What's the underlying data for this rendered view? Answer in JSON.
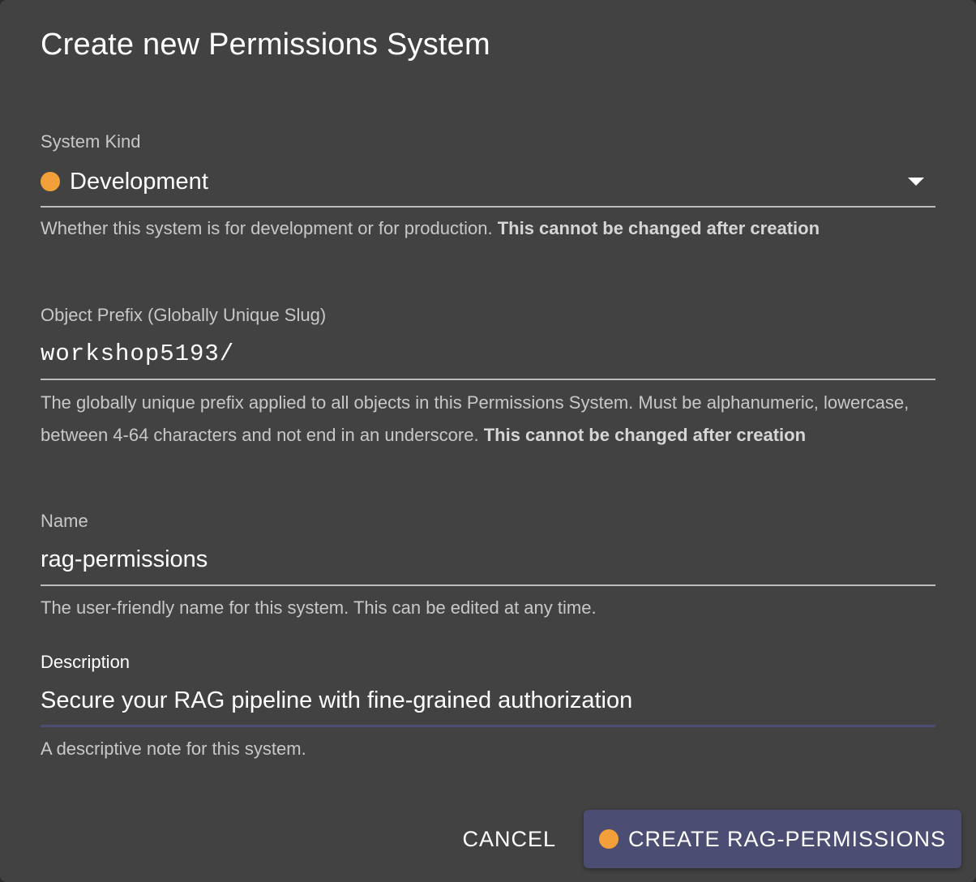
{
  "dialog": {
    "title": "Create new Permissions System"
  },
  "system_kind": {
    "label": "System Kind",
    "value": "Development",
    "status_color": "#f2a03a",
    "helper_text": "Whether this system is for development or for production.",
    "helper_bold": "This cannot be changed after creation"
  },
  "object_prefix": {
    "label": "Object Prefix (Globally Unique Slug)",
    "value": "workshop5193/",
    "helper_text": "The globally unique prefix applied to all objects in this Permissions System. Must be alphanumeric, lowercase, between 4-64 characters and not end in an underscore.",
    "helper_bold": "This cannot be changed after creation"
  },
  "name": {
    "label": "Name",
    "value": "rag-permissions",
    "helper_text": "The user-friendly name for this system. This can be edited at any time."
  },
  "description": {
    "label": "Description",
    "value": "Secure your RAG pipeline with fine-grained authorization",
    "helper_text": "A descriptive note for this system."
  },
  "actions": {
    "cancel_label": "CANCEL",
    "create_label": "CREATE RAG-PERMISSIONS",
    "accent_color": "#4b4e72"
  }
}
